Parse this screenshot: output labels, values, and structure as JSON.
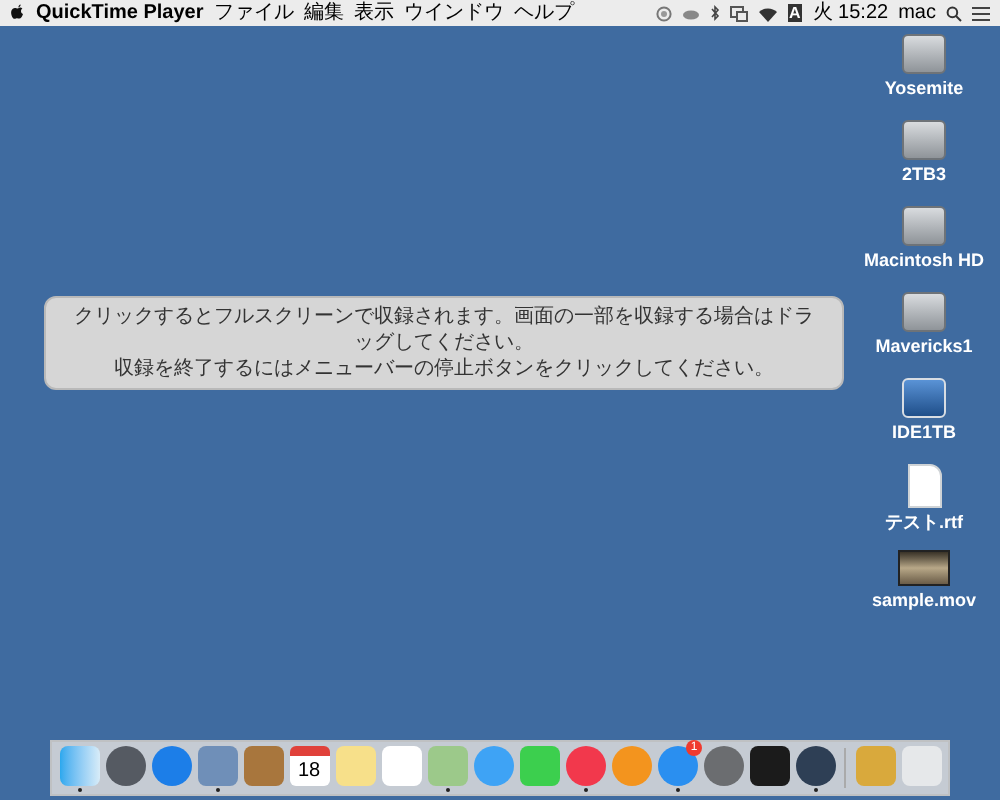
{
  "menu_bar": {
    "app_name": "QuickTime Player",
    "menus": [
      "ファイル",
      "編集",
      "表示",
      "ウインドウ",
      "ヘルプ"
    ],
    "input_source": "A",
    "clock": "火 15:22",
    "user": "mac"
  },
  "overlay_message": {
    "lines": [
      "クリックするとフルスクリーンで収録されます。画面の一部を収録する場合はドラッグしてください。",
      "収録を終了するにはメニューバーの停止ボタンをクリックしてください。"
    ]
  },
  "desktop_icons": [
    {
      "kind": "drive",
      "label": "Yosemite"
    },
    {
      "kind": "drive",
      "label": "2TB3"
    },
    {
      "kind": "drive",
      "label": "Macintosh HD"
    },
    {
      "kind": "drive",
      "label": "Mavericks1"
    },
    {
      "kind": "usb_drive",
      "label": "IDE1TB"
    },
    {
      "kind": "document",
      "label": "テスト.rtf"
    },
    {
      "kind": "movie",
      "label": "sample.mov"
    }
  ],
  "dock": [
    {
      "kind": "finder",
      "running": true
    },
    {
      "kind": "launchpad",
      "running": false
    },
    {
      "kind": "safari",
      "running": false
    },
    {
      "kind": "preview",
      "running": true
    },
    {
      "kind": "contacts",
      "running": false
    },
    {
      "kind": "calendar",
      "running": false,
      "text": "18"
    },
    {
      "kind": "notes",
      "running": false
    },
    {
      "kind": "reminders",
      "running": false
    },
    {
      "kind": "maps",
      "running": true
    },
    {
      "kind": "messages",
      "running": false
    },
    {
      "kind": "facetime",
      "running": false
    },
    {
      "kind": "itunes",
      "running": true
    },
    {
      "kind": "ibooks",
      "running": false
    },
    {
      "kind": "appstore",
      "running": true,
      "badge": "1"
    },
    {
      "kind": "preferences",
      "running": false
    },
    {
      "kind": "terminal",
      "running": false
    },
    {
      "kind": "quicktime",
      "running": true
    },
    {
      "kind": "separator"
    },
    {
      "kind": "downloads",
      "running": false
    },
    {
      "kind": "trash",
      "running": false
    }
  ]
}
